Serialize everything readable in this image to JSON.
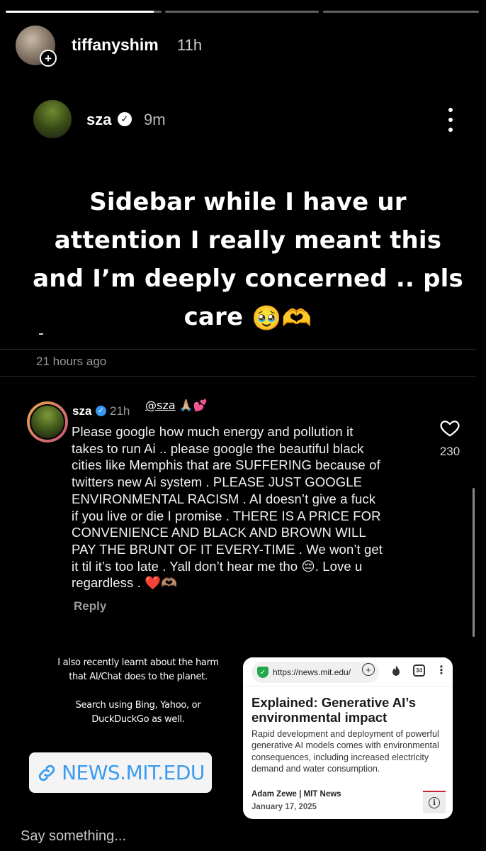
{
  "story": {
    "progress_segments": [
      1.0,
      0.0,
      0.0
    ],
    "active_segment_fill": 0.95,
    "poster": {
      "username": "tiffanyshim",
      "time": "11h"
    }
  },
  "shared_post": {
    "username": "sza",
    "time": "9m",
    "text": "Sidebar while I have ur attention I really meant this and I’m deeply concerned .. pls care",
    "text_emoji": "🥹🫶",
    "timestamp": "21 hours ago"
  },
  "comment": {
    "username": "sza",
    "time": "21h",
    "mention_sticker": "@sza",
    "mention_emoji": "🙏🏼💕",
    "text": "Please google how much energy  and pollution it\ntakes to run Ai .. please google the beautiful black\ncities like Memphis that are SUFFERING because of\ntwitters new Ai system . PLEASE JUST GOOGLE\nENVIRONMENTAL RACISM . AI doesn’t give a fuck\nif you live or die I promise . THERE IS A PRICE FOR\nCONVENIENCE AND BLACK AND BROWN WILL\nPAY THE BRUNT OF IT EVERY-TIME . We won’t get\nit til it’s too late . Yall don’t hear me tho 😔. Love u\nregardless . ❤️🫶🏽",
    "like_count": "230",
    "reply_label": "Reply"
  },
  "note": {
    "text": "I also recently learnt about the harm\nthat AI/Chat does to the planet.\n\nSearch using Bing, Yahoo, or\nDuckDuckGo as well."
  },
  "link_sticker": {
    "label": "NEWS.MIT.EDU",
    "icon": "link-icon"
  },
  "article_card": {
    "url": "https://news.mit.edu/",
    "tab_count": "34",
    "title": "Explained: Generative AI’s environmental impact",
    "description": "Rapid development and deployment of powerful generative AI models comes with environmental consequences, including increased electricity demand and water consumption.",
    "author": "Adam Zewe | MIT News",
    "date": "January 17, 2025"
  },
  "composer": {
    "placeholder": "Say something..."
  },
  "colors": {
    "background": "#000000",
    "link": "#3a9bf0",
    "verified_blue": "#3897f0",
    "shield_green": "#20a84a"
  }
}
